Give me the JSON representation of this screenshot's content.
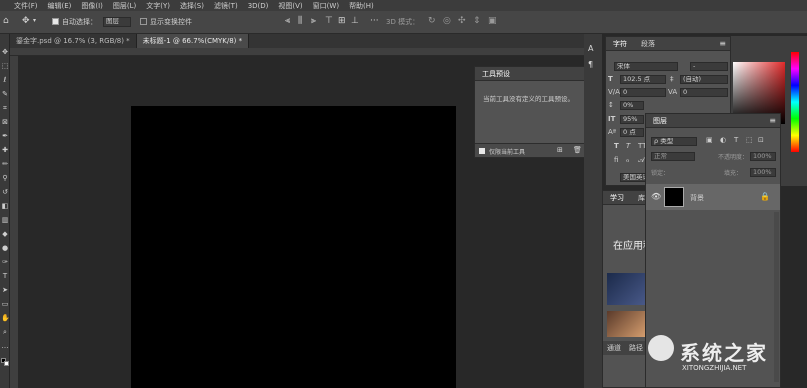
{
  "menubar": {
    "items": [
      "文件(F)",
      "编辑(E)",
      "图像(I)",
      "图层(L)",
      "文字(Y)",
      "选择(S)",
      "滤镜(T)",
      "3D(D)",
      "视图(V)",
      "窗口(W)",
      "帮助(H)"
    ]
  },
  "options": {
    "autoselect_label": "自动选择：",
    "autoselect_value": "图层",
    "transform_label": "显示变换控件",
    "mode3d_label": "3D 模式："
  },
  "tabs": [
    {
      "label": "鎏金字.psd @ 16.7% (3, RGB/8) *"
    },
    {
      "label": "未标题-1 @ 66.7%(CMYK/8) *"
    }
  ],
  "tool_presets": {
    "title": "工具预设",
    "message": "当前工具没有定义的工具预设。",
    "current_tool_label": "仅限当前工具"
  },
  "character": {
    "tabs": [
      "字符",
      "段落"
    ],
    "font_family": "宋体",
    "font_style": "-",
    "font_size": "102.5 点",
    "leading": "(自动)",
    "kerning": "0",
    "tracking": "0",
    "vscale": "0%",
    "hscale": "95%",
    "baseline": "0 点",
    "language": "美国英语"
  },
  "layers": {
    "title": "图层",
    "kind_label": "ρ 类型",
    "blend": "正常",
    "opacity_label": "不透明度：",
    "opacity": "100%",
    "lock_label": "锁定：",
    "fill_label": "填充：",
    "fill": "100%",
    "items": [
      {
        "name": "背景"
      }
    ]
  },
  "learn": {
    "tabs": [
      "学习",
      "库"
    ],
    "heading": "在应用程",
    "bottom_tabs": [
      "通道",
      "路径"
    ]
  },
  "watermark": {
    "brand": "系统之家",
    "url": "XITONGZHIJIA.NET"
  },
  "colors": {
    "accent": "#e02a2a"
  }
}
